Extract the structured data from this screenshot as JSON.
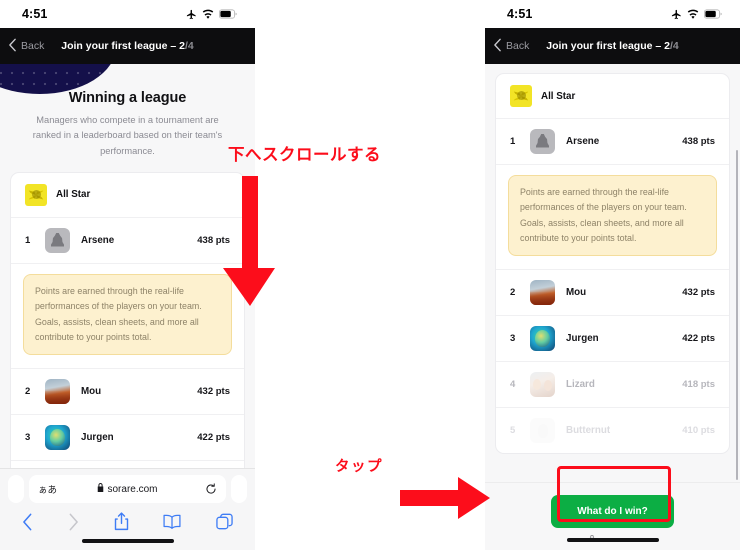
{
  "status_bar": {
    "time": "4:51",
    "icons": [
      "airplane-mode-icon",
      "wifi-icon",
      "battery-icon"
    ]
  },
  "nav": {
    "back_label": "Back",
    "title_main": "Join your first league – ",
    "title_step": "2",
    "title_total": "/4"
  },
  "hero": {
    "title": "Winning a league",
    "subtitle": "Managers who compete in a tournament are ranked in a leaderboard based on their team's performance."
  },
  "leaderboard": {
    "header_label": "All Star",
    "rows": [
      {
        "rank": "1",
        "name": "Arsene",
        "points": "438 pts",
        "avatar": "av-arsene",
        "state": "normal"
      },
      {
        "rank": "2",
        "name": "Mou",
        "points": "432 pts",
        "avatar": "av-mou",
        "state": "normal"
      },
      {
        "rank": "3",
        "name": "Jurgen",
        "points": "422 pts",
        "avatar": "av-jurgen",
        "state": "normal"
      },
      {
        "rank": "4",
        "name": "Lizard",
        "points": "418 pts",
        "avatar": "av-lizard",
        "state": "faded-1"
      },
      {
        "rank": "5",
        "name": "Butternut",
        "points": "410 pts",
        "avatar": "av-butternut",
        "state": "faded-2"
      }
    ]
  },
  "tooltip": {
    "text": "Points are earned through the real-life performances of the players on your team. Goals, assists, clean sheets, and more all contribute to your points total."
  },
  "cta": {
    "button_label": "What do I win?",
    "url_label": "sorare.com",
    "lock_icon": "lock-icon"
  },
  "safari": {
    "aa_label": "ぁあ",
    "url": "sorare.com",
    "lock_icon": "lock-icon",
    "reload_icon": "reload-icon",
    "back_icon": "chevron-left-icon",
    "forward_icon": "chevron-right-icon",
    "share_icon": "share-icon",
    "bookmarks_icon": "book-icon",
    "tabs_icon": "tabs-icon"
  },
  "annotations": {
    "scroll_label": "下へスクロールする",
    "tap_label": "タップ",
    "arrow_down": "arrow-down-icon",
    "arrow_right": "arrow-right-icon",
    "highlight": "focus-ring"
  },
  "colors": {
    "annotation_red": "#fc0d1b",
    "cta_green": "#0cae44",
    "navbar_black": "#0d0d0f",
    "tooltip_bg": "#fdf1cf",
    "tooltip_border": "#f4dd9c",
    "allstar_yellow": "#f2e426",
    "blob_navy": "#14104a",
    "safari_blue": "#3e7cf5"
  }
}
